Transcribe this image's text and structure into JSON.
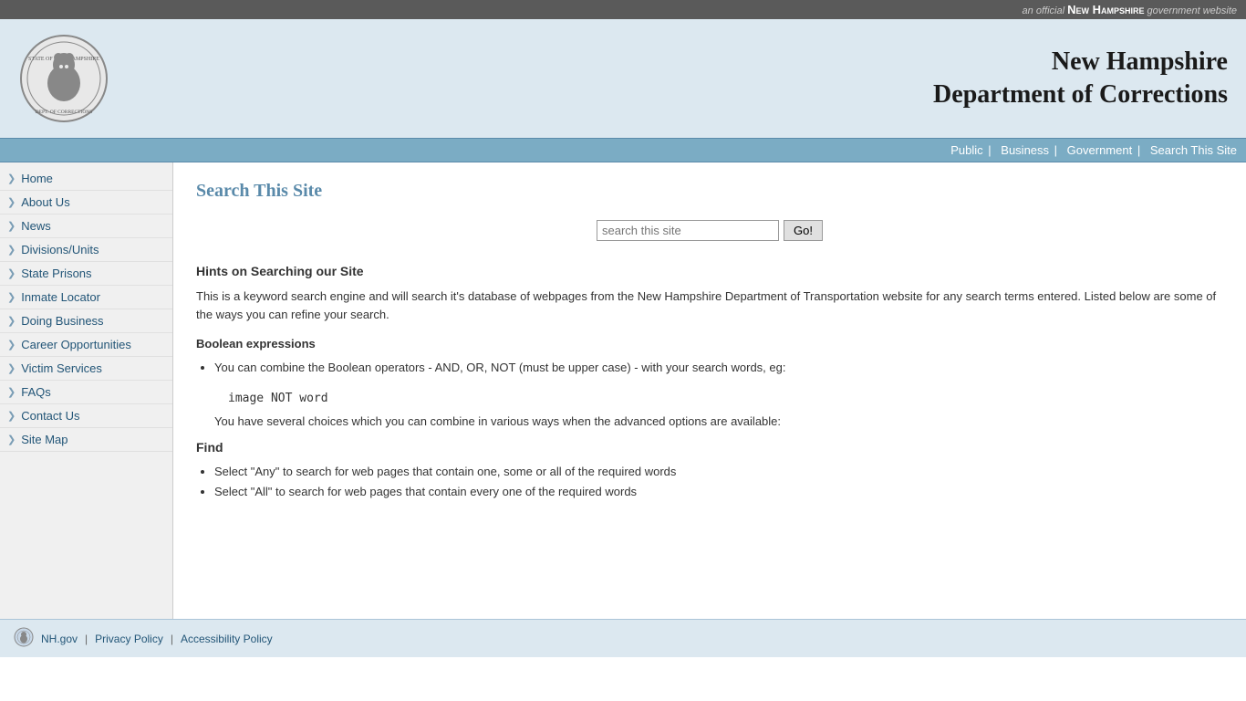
{
  "topbar": {
    "prefix": "an official",
    "name": "New Hampshire",
    "suffix": "government website"
  },
  "header": {
    "title_line1": "New Hampshire",
    "title_line2": "Department of Corrections"
  },
  "navbar": {
    "items": [
      {
        "label": "Public",
        "href": "#"
      },
      {
        "label": "Business",
        "href": "#"
      },
      {
        "label": "Government",
        "href": "#"
      },
      {
        "label": "Search This Site",
        "href": "#"
      }
    ]
  },
  "sidebar": {
    "items": [
      {
        "label": "Home",
        "name": "sidebar-item-home"
      },
      {
        "label": "About Us",
        "name": "sidebar-item-about"
      },
      {
        "label": "News",
        "name": "sidebar-item-news"
      },
      {
        "label": "Divisions/Units",
        "name": "sidebar-item-divisions"
      },
      {
        "label": "State Prisons",
        "name": "sidebar-item-prisons"
      },
      {
        "label": "Inmate Locator",
        "name": "sidebar-item-inmate"
      },
      {
        "label": "Doing Business",
        "name": "sidebar-item-business"
      },
      {
        "label": "Career Opportunities",
        "name": "sidebar-item-careers"
      },
      {
        "label": "Victim Services",
        "name": "sidebar-item-victim"
      },
      {
        "label": "FAQs",
        "name": "sidebar-item-faqs"
      },
      {
        "label": "Contact Us",
        "name": "sidebar-item-contact"
      },
      {
        "label": "Site Map",
        "name": "sidebar-item-sitemap"
      }
    ]
  },
  "main": {
    "page_title": "Search This Site",
    "search_placeholder": "search this site",
    "search_button_label": "Go!",
    "hints_title": "Hints on Searching our Site",
    "hints_desc": "This is a keyword search engine and will search it's database of webpages from the New Hampshire Department of Transportation website for any search terms entered. Listed below are some of the ways you can refine your search.",
    "boolean_title": "Boolean expressions",
    "boolean_text": "You can combine the Boolean operators - AND, OR, NOT (must be upper case) - with your search words, eg:",
    "boolean_example": "image NOT word",
    "boolean_text2": "You have several choices which you can combine in various ways when the advanced options are available:",
    "find_title": "Find",
    "find_items": [
      "Select \"Any\" to search for web pages that contain one, some or all of the required words",
      "Select \"All\" to search for web pages that contain every one of the required words"
    ]
  },
  "footer": {
    "links": [
      {
        "label": "NH.gov",
        "href": "#"
      },
      {
        "label": "Privacy Policy",
        "href": "#"
      },
      {
        "label": "Accessibility Policy",
        "href": "#"
      }
    ]
  }
}
